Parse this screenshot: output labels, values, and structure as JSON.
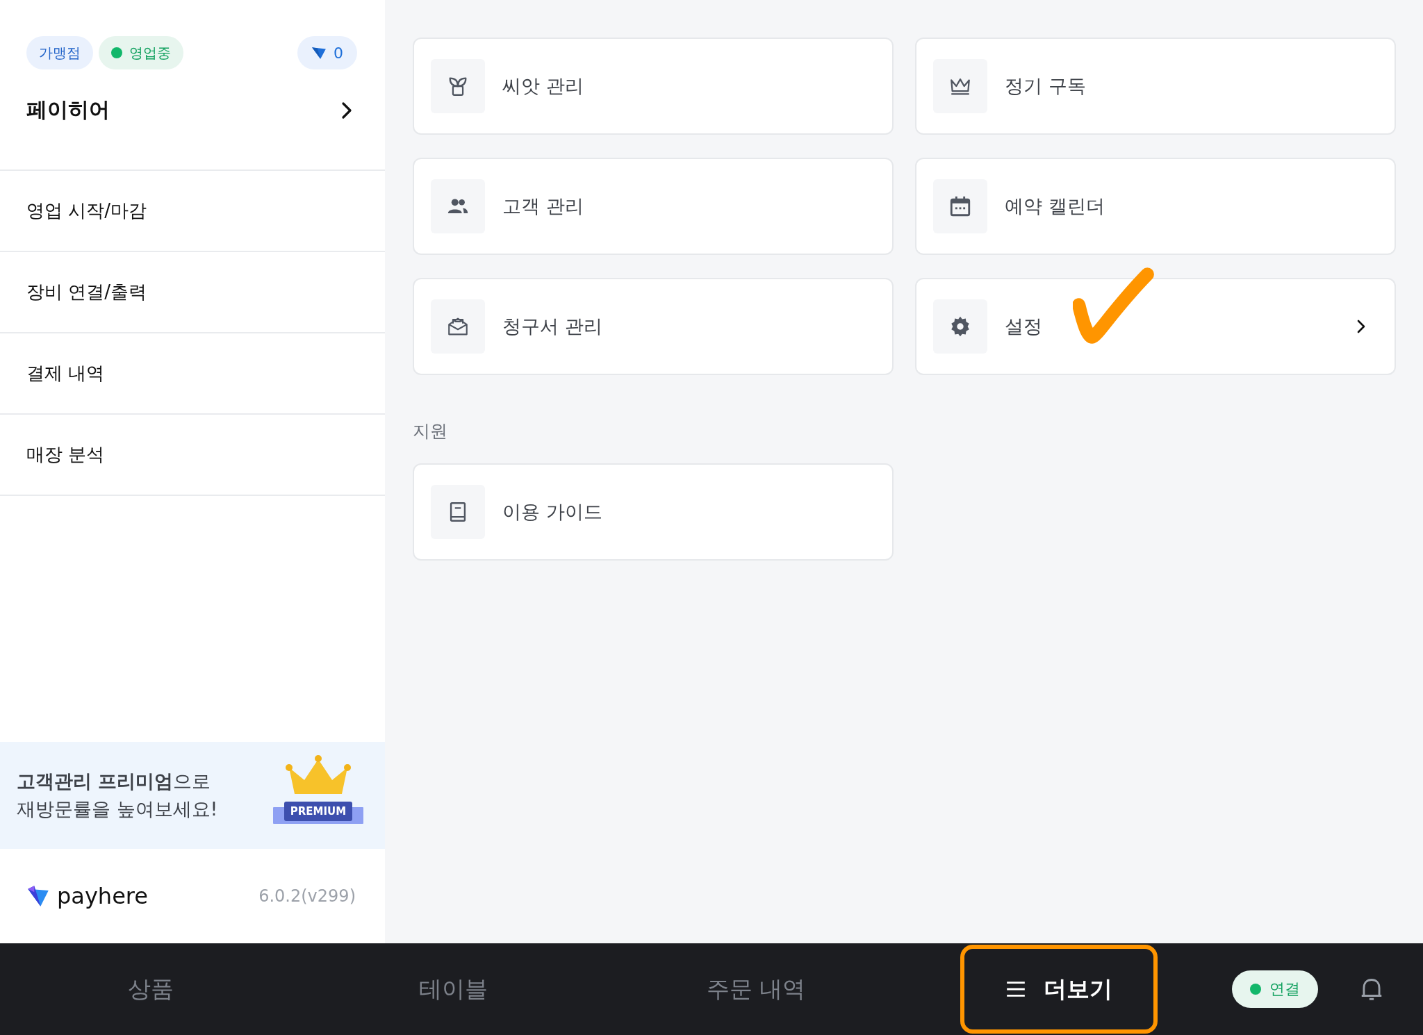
{
  "sidebar": {
    "badges": [
      {
        "label": "가맹점",
        "kind": "tag"
      },
      {
        "label": "영업중",
        "kind": "status",
        "color": "#12b76a"
      }
    ],
    "points": "0",
    "store_name": "페이히어",
    "menu": [
      "영업 시작/마감",
      "장비 연결/출력",
      "결제 내역",
      "매장 분석"
    ],
    "banner": {
      "lines": [
        "**고객관리 프리미엄**으로",
        "재방문률을 높여보세요!"
      ],
      "badge": "PREMIUM"
    },
    "footer": {
      "brand": "payhere",
      "version": "6.0.2(v299)"
    }
  },
  "sections": [
    {
      "items": [
        {
          "label": "씨앗 관리",
          "kind": "sprout",
          "has_arrow": false
        },
        {
          "label": "정기 구독",
          "kind": "crown",
          "has_arrow": false
        },
        {
          "label": "고객 관리",
          "kind": "people",
          "has_arrow": false
        },
        {
          "label": "예약 캘린더",
          "kind": "calendar",
          "has_arrow": false
        },
        {
          "label": "청구서 관리",
          "kind": "envelope",
          "has_arrow": false
        },
        {
          "label": "설정",
          "kind": "gear",
          "has_arrow": true
        }
      ]
    },
    {
      "heading": "지원",
      "items": [
        {
          "label": "이용 가이드",
          "kind": "book",
          "has_arrow": false
        }
      ]
    }
  ],
  "bottom_nav": {
    "tabs": [
      {
        "label": "상품",
        "selected": false
      },
      {
        "label": "테이블",
        "selected": false
      },
      {
        "label": "주문 내역",
        "selected": false
      },
      {
        "label": "더보기",
        "selected": true
      }
    ],
    "connection": {
      "label": "연결",
      "on": true
    }
  }
}
